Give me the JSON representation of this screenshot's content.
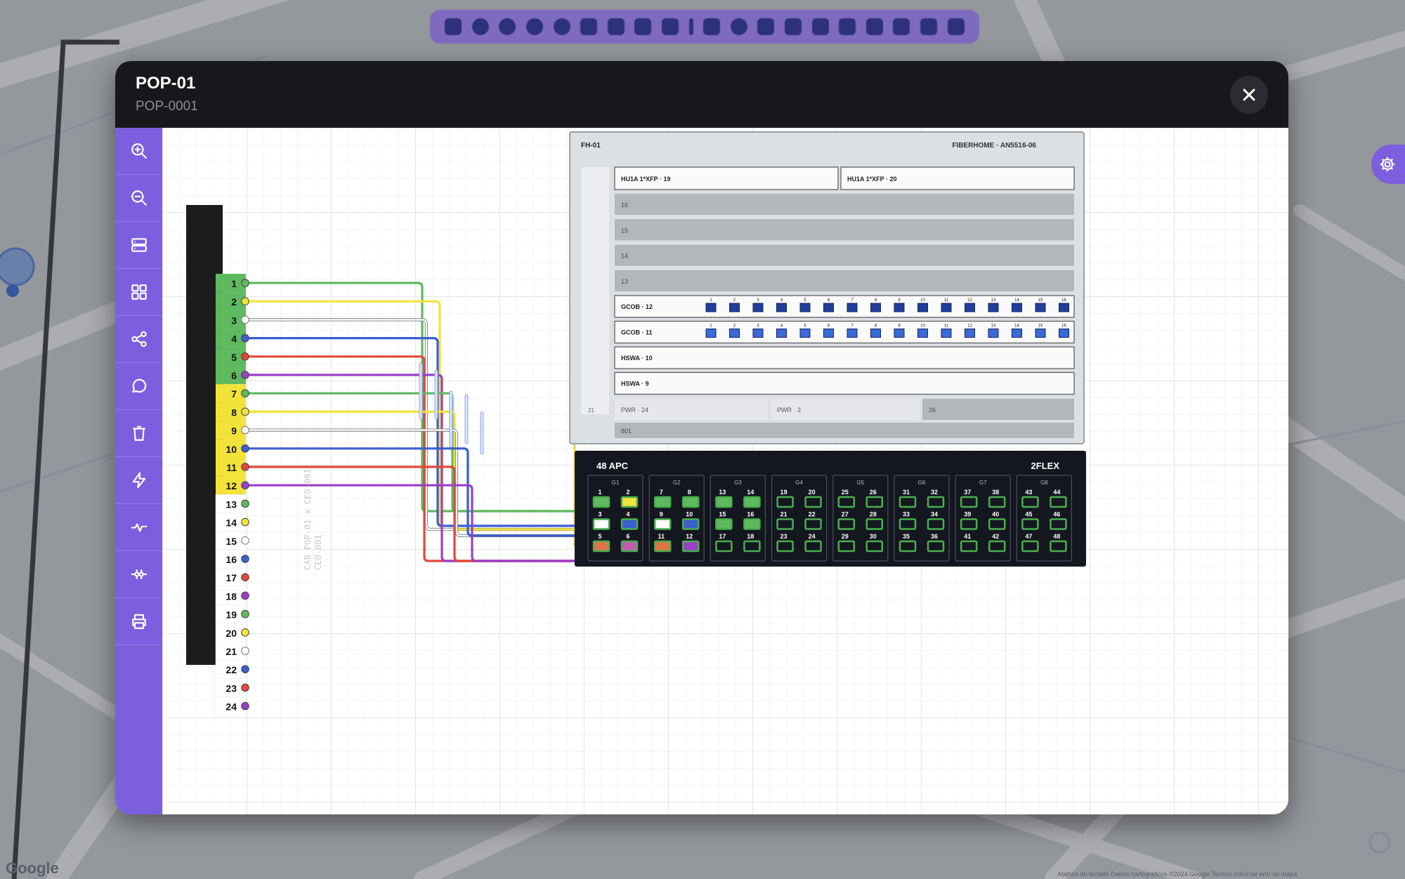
{
  "map": {
    "attribution_left": "Google",
    "attribution_right": "Atalhos do teclado   Dados cartográficos ©2024 Google   Termos   Informar erro no mapa"
  },
  "modal": {
    "title": "POP-01",
    "subtitle": "POP-0001"
  },
  "sidebar": {
    "items": [
      {
        "name": "zoom-in-icon"
      },
      {
        "name": "zoom-out-icon"
      },
      {
        "name": "rack-icon"
      },
      {
        "name": "grid-icon"
      },
      {
        "name": "share-icon"
      },
      {
        "name": "comment-icon"
      },
      {
        "name": "trash-icon"
      },
      {
        "name": "lightning-icon"
      },
      {
        "name": "pulse-icon"
      },
      {
        "name": "connector-icon"
      },
      {
        "name": "print-icon"
      }
    ]
  },
  "cable": {
    "label_line1": "CAB_POP-01 x CEO-001",
    "label_line2": "CEO-001",
    "fibers": [
      {
        "n": "1",
        "color": "#5fb95f"
      },
      {
        "n": "2",
        "color": "#f2e33a"
      },
      {
        "n": "3",
        "color": "#ffffff"
      },
      {
        "n": "4",
        "color": "#3a5fcf"
      },
      {
        "n": "5",
        "color": "#e0483a"
      },
      {
        "n": "6",
        "color": "#9b3fc8"
      },
      {
        "n": "7",
        "color": "#5fb95f"
      },
      {
        "n": "8",
        "color": "#f2e33a"
      },
      {
        "n": "9",
        "color": "#ffffff"
      },
      {
        "n": "10",
        "color": "#3a5fcf"
      },
      {
        "n": "11",
        "color": "#e0483a"
      },
      {
        "n": "12",
        "color": "#9b3fc8"
      },
      {
        "n": "13",
        "color": "#5fb95f"
      },
      {
        "n": "14",
        "color": "#f2e33a"
      },
      {
        "n": "15",
        "color": "#ffffff"
      },
      {
        "n": "16",
        "color": "#3a5fcf"
      },
      {
        "n": "17",
        "color": "#e0483a"
      },
      {
        "n": "18",
        "color": "#9b3fc8"
      },
      {
        "n": "19",
        "color": "#5fb95f"
      },
      {
        "n": "20",
        "color": "#f2e33a"
      },
      {
        "n": "21",
        "color": "#ffffff"
      },
      {
        "n": "22",
        "color": "#3a5fcf"
      },
      {
        "n": "23",
        "color": "#e0483a"
      },
      {
        "n": "24",
        "color": "#9b3fc8"
      }
    ],
    "tube_colors": [
      "#5fb95f",
      "#f2e33a",
      "#ffffff",
      "#ffffff"
    ]
  },
  "olt": {
    "name": "FH-01",
    "model": "FIBERHOME · AN5516-06",
    "left_slot": "21",
    "cards": [
      {
        "label": "HU1A 1*XFP · 19"
      },
      {
        "label": "HU1A 1*XFP · 20"
      }
    ],
    "empty_slots": [
      "16",
      "15",
      "14",
      "13"
    ],
    "gcob_cards": [
      {
        "label": "GCOB · 12",
        "port_count": 16
      },
      {
        "label": "GCOB · 11",
        "port_count": 16
      }
    ],
    "hswa_cards": [
      {
        "label": "HSWA · 10"
      },
      {
        "label": "HSWA · 9"
      }
    ],
    "pwr_slots": [
      "PWR · 24",
      "PWR · 2"
    ],
    "slot_26": "26",
    "slot_801": "801"
  },
  "dio": {
    "title": "48 APC",
    "flex": "2FLEX",
    "groups": [
      {
        "label": "G1",
        "ports": [
          "1",
          "2",
          "3",
          "4",
          "5",
          "6"
        ]
      },
      {
        "label": "G2",
        "ports": [
          "7",
          "8",
          "9",
          "10",
          "11",
          "12"
        ]
      },
      {
        "label": "G3",
        "ports": [
          "13",
          "14",
          "15",
          "16",
          "17",
          "18"
        ]
      },
      {
        "label": "G4",
        "ports": [
          "19",
          "20",
          "21",
          "22",
          "23",
          "24"
        ]
      },
      {
        "label": "G5",
        "ports": [
          "25",
          "26",
          "27",
          "28",
          "29",
          "30"
        ]
      },
      {
        "label": "G6",
        "ports": [
          "31",
          "32",
          "33",
          "34",
          "35",
          "36"
        ]
      },
      {
        "label": "G7",
        "ports": [
          "37",
          "38",
          "39",
          "40",
          "41",
          "42"
        ]
      },
      {
        "label": "G8",
        "ports": [
          "43",
          "44",
          "45",
          "46",
          "47",
          "48"
        ]
      }
    ],
    "port_fill": {
      "1": "#5fb95f",
      "2": "#f2e33a",
      "3": "#ffffff",
      "4": "#3a5fcf",
      "5": "#e0734a",
      "6": "#c35ab0",
      "7": "#5fb95f",
      "8": "#5fb95f",
      "9": "#ffffff",
      "10": "#3a5fcf",
      "11": "#e0734a",
      "12": "#9b3fc8",
      "13": "#5fb95f",
      "14": "#5fb95f",
      "15": "#5fb95f",
      "16": "#5fb95f"
    }
  },
  "colors": {
    "accent": "#7c5fde",
    "header": "#17181b",
    "dio_bg": "#141720",
    "port_green": "#48b04b",
    "olt_port": "#2f5fc9",
    "yellow_patch": "#f2cf3f"
  }
}
